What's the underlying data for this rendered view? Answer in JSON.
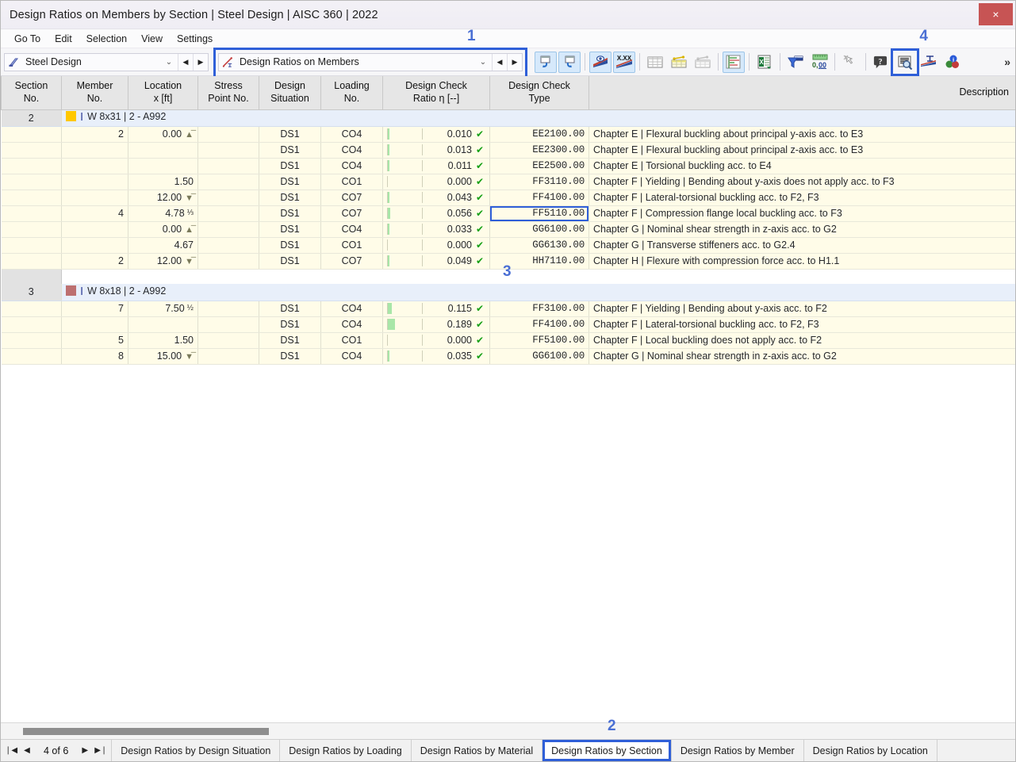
{
  "window": {
    "title": "Design Ratios on Members by Section | Steel Design | AISC 360 | 2022",
    "close_label": "×"
  },
  "menubar": {
    "items": [
      "Go To",
      "Edit",
      "Selection",
      "View",
      "Settings"
    ]
  },
  "toolbar": {
    "combo_module": {
      "value": "Steel Design",
      "icon": "steel-beam-icon",
      "caret": "⌄",
      "prev": "◀",
      "next": "▶"
    },
    "combo_table": {
      "value": "Design Ratios on Members",
      "icon": "design-ratio-icon",
      "caret": "⌄",
      "prev": "◀",
      "next": "▶"
    },
    "buttons": [
      {
        "name": "undo-navigation-icon",
        "on": true
      },
      {
        "name": "redo-navigation-icon",
        "on": true
      },
      {
        "name": "visibility-results-icon",
        "on": true
      },
      {
        "name": "decimal-places-icon",
        "on": true
      },
      {
        "name": "table-all-icon",
        "on": false
      },
      {
        "name": "table-filled-icon",
        "on": false
      },
      {
        "name": "table-empty-icon",
        "on": false
      },
      {
        "name": "result-diagram-icon",
        "on": true
      },
      {
        "name": "export-excel-icon",
        "on": false
      },
      {
        "name": "filter-icon",
        "on": false
      },
      {
        "name": "units-decimal-icon",
        "on": false
      },
      {
        "name": "selection-pointer-icon",
        "on": false
      },
      {
        "name": "help-icon",
        "on": false
      },
      {
        "name": "table-zoom-icon",
        "on": false
      },
      {
        "name": "section-view-icon",
        "on": false
      },
      {
        "name": "info-colors-icon",
        "on": false
      }
    ],
    "overflow": "»"
  },
  "annotations": [
    {
      "id": "1",
      "label": "1"
    },
    {
      "id": "2",
      "label": "2"
    },
    {
      "id": "3",
      "label": "3"
    },
    {
      "id": "4",
      "label": "4"
    }
  ],
  "table": {
    "headers": [
      "Section\nNo.",
      "Member\nNo.",
      "Location\nx [ft]",
      "Stress\nPoint No.",
      "Design\nSituation",
      "Loading\nNo.",
      "Design Check\nRatio η [--]",
      "Design Check\nType",
      "Description"
    ],
    "groups": [
      {
        "section_no": "2",
        "group_label": "W 8x31 | 2 - A992",
        "swatch_color": "#ffc800",
        "rows": [
          {
            "member": "2",
            "location": "0.00",
            "loc_sym": "min",
            "stress_point": "",
            "ds": "DS1",
            "loading": "CO4",
            "ratio": "0.010",
            "bar_pct": 1.0,
            "type": "EE2100.00",
            "desc": "Chapter E | Flexural buckling about principal y-axis acc. to E3"
          },
          {
            "member": "",
            "location": "",
            "loc_sym": "",
            "stress_point": "",
            "ds": "DS1",
            "loading": "CO4",
            "ratio": "0.013",
            "bar_pct": 1.3,
            "type": "EE2300.00",
            "desc": "Chapter E | Flexural buckling about principal z-axis acc. to E3"
          },
          {
            "member": "",
            "location": "",
            "loc_sym": "",
            "stress_point": "",
            "ds": "DS1",
            "loading": "CO4",
            "ratio": "0.011",
            "bar_pct": 1.1,
            "type": "EE2500.00",
            "desc": "Chapter E | Torsional buckling acc. to E4"
          },
          {
            "member": "",
            "location": "1.50",
            "loc_sym": "",
            "stress_point": "",
            "ds": "DS1",
            "loading": "CO1",
            "ratio": "0.000",
            "bar_pct": 0.0,
            "type": "FF3110.00",
            "desc": "Chapter F | Yielding | Bending about y-axis does not apply acc. to F3"
          },
          {
            "member": "",
            "location": "12.00",
            "loc_sym": "max",
            "stress_point": "",
            "ds": "DS1",
            "loading": "CO7",
            "ratio": "0.043",
            "bar_pct": 4.3,
            "type": "FF4100.00",
            "desc": "Chapter F | Lateral-torsional buckling acc. to F2, F3"
          },
          {
            "member": "4",
            "location": "4.78",
            "loc_sym": "",
            "frac": "⅓",
            "stress_point": "",
            "ds": "DS1",
            "loading": "CO7",
            "ratio": "0.056",
            "bar_pct": 5.6,
            "type": "FF5110.00",
            "desc": "Chapter F | Compression flange local buckling acc. to F3",
            "highlight": true
          },
          {
            "member": "",
            "location": "0.00",
            "loc_sym": "min",
            "stress_point": "",
            "ds": "DS1",
            "loading": "CO4",
            "ratio": "0.033",
            "bar_pct": 3.3,
            "type": "GG6100.00",
            "desc": "Chapter G | Nominal shear strength in z-axis acc. to G2"
          },
          {
            "member": "",
            "location": "4.67",
            "loc_sym": "",
            "stress_point": "",
            "ds": "DS1",
            "loading": "CO1",
            "ratio": "0.000",
            "bar_pct": 0.0,
            "type": "GG6130.00",
            "desc": "Chapter G | Transverse stiffeners acc. to G2.4"
          },
          {
            "member": "2",
            "location": "12.00",
            "loc_sym": "max",
            "stress_point": "",
            "ds": "DS1",
            "loading": "CO7",
            "ratio": "0.049",
            "bar_pct": 4.9,
            "type": "HH7110.00",
            "desc": "Chapter H | Flexure with compression force acc. to H1.1"
          }
        ]
      },
      {
        "section_no": "3",
        "group_label": "W 8x18 | 2 - A992",
        "swatch_color": "#bd7070",
        "rows": [
          {
            "member": "7",
            "location": "7.50",
            "loc_sym": "",
            "frac": "½",
            "stress_point": "",
            "ds": "DS1",
            "loading": "CO4",
            "ratio": "0.115",
            "bar_pct": 11.5,
            "type": "FF3100.00",
            "desc": "Chapter F | Yielding | Bending about y-axis acc. to F2"
          },
          {
            "member": "",
            "location": "",
            "loc_sym": "",
            "stress_point": "",
            "ds": "DS1",
            "loading": "CO4",
            "ratio": "0.189",
            "bar_pct": 18.9,
            "type": "FF4100.00",
            "desc": "Chapter F | Lateral-torsional buckling acc. to F2, F3"
          },
          {
            "member": "5",
            "location": "1.50",
            "loc_sym": "",
            "stress_point": "",
            "ds": "DS1",
            "loading": "CO1",
            "ratio": "0.000",
            "bar_pct": 0.0,
            "type": "FF5100.00",
            "desc": "Chapter F | Local buckling does not apply acc. to F2"
          },
          {
            "member": "8",
            "location": "15.00",
            "loc_sym": "max",
            "stress_point": "",
            "ds": "DS1",
            "loading": "CO4",
            "ratio": "0.035",
            "bar_pct": 3.5,
            "type": "GG6100.00",
            "desc": "Chapter G | Nominal shear strength in z-axis acc. to G2"
          }
        ]
      }
    ]
  },
  "statusbar": {
    "first_label": "❘◀",
    "prev_label": "◀",
    "pager": "4 of 6",
    "next_label": "▶",
    "last_label": "▶❘",
    "tabs": [
      {
        "label": "Design Ratios by Design Situation",
        "active": false
      },
      {
        "label": "Design Ratios by Loading",
        "active": false
      },
      {
        "label": "Design Ratios by Material",
        "active": false
      },
      {
        "label": "Design Ratios by Section",
        "active": true
      },
      {
        "label": "Design Ratios by Member",
        "active": false
      },
      {
        "label": "Design Ratios by Location",
        "active": false
      }
    ]
  },
  "colors": {
    "annotation": "#2f5fd8",
    "check_ok": "#15a015",
    "bar_green": "#a8e6a8",
    "row_bg": "#fffce8",
    "group_bg": "#e8effa"
  }
}
